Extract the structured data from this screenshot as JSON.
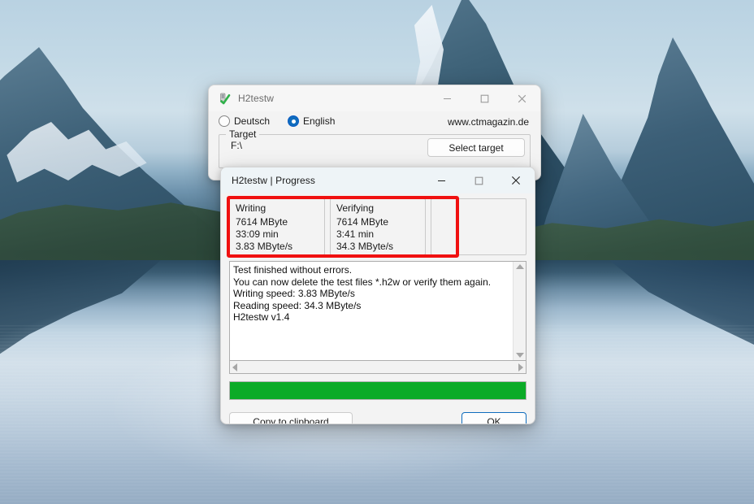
{
  "main_window": {
    "title": "H2testw",
    "icon": "h2testw-app-icon",
    "window_controls": {
      "minimize": "minimize-icon",
      "maximize": "maximize-icon",
      "close": "close-icon"
    },
    "language": {
      "options": [
        {
          "label": "Deutsch",
          "selected": false
        },
        {
          "label": "English",
          "selected": true
        }
      ]
    },
    "url": "www.ctmagazin.de",
    "target_group": {
      "legend": "Target",
      "path": "F:\\",
      "select_button": "Select target"
    }
  },
  "progress_window": {
    "title": "H2testw | Progress",
    "window_controls": {
      "minimize": "minimize-icon",
      "maximize": "maximize-icon",
      "close": "close-icon"
    },
    "stats": [
      {
        "heading": "Writing",
        "size": "7614 MByte",
        "time": "33:09 min",
        "speed": "3.83 MByte/s"
      },
      {
        "heading": "Verifying",
        "size": "7614 MByte",
        "time": "3:41 min",
        "speed": "34.3 MByte/s"
      },
      {
        "heading": "",
        "size": "",
        "time": "",
        "speed": ""
      }
    ],
    "log": "Test finished without errors.\nYou can now delete the test files *.h2w or verify them again.\nWriting speed: 3.83 MByte/s\nReading speed: 34.3 MByte/s\nH2testw v1.4",
    "progress": {
      "percent": 100,
      "fill_color": "#0bab27"
    },
    "buttons": {
      "copy": "Copy to clipboard",
      "ok": "OK"
    },
    "scrollbars": {
      "vertical_up": "scroll-up-arrow-icon",
      "vertical_down": "scroll-down-arrow-icon",
      "horizontal_left": "scroll-left-arrow-icon",
      "horizontal_right": "scroll-right-arrow-icon"
    }
  },
  "annotation": {
    "highlight_color": "#f01010",
    "label": "red-highlight-rectangle"
  },
  "desktop": {
    "wallpaper": "mountain-lake-wallpaper"
  }
}
